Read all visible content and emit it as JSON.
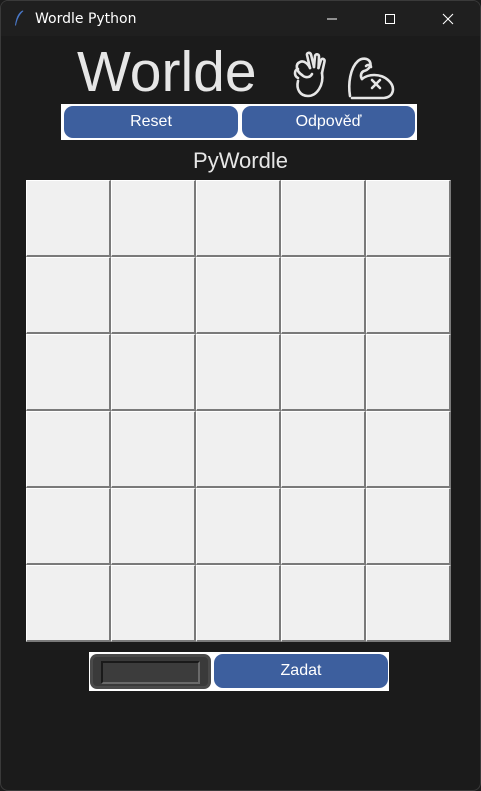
{
  "window": {
    "title": "Wordle Python",
    "icon": "feather-icon",
    "controls": [
      "minimize-icon",
      "maximize-icon",
      "close-icon"
    ]
  },
  "header": {
    "title": "Worlde",
    "icons": [
      "ok-hand-icon",
      "flexed-biceps-icon"
    ]
  },
  "buttons": {
    "reset_label": "Reset",
    "answer_label": "Odpověď"
  },
  "subtitle": "PyWordle",
  "board": {
    "rows": 6,
    "columns": 5,
    "cells": [
      [
        "",
        "",
        "",
        "",
        ""
      ],
      [
        "",
        "",
        "",
        "",
        ""
      ],
      [
        "",
        "",
        "",
        "",
        ""
      ],
      [
        "",
        "",
        "",
        "",
        ""
      ],
      [
        "",
        "",
        "",
        "",
        ""
      ],
      [
        "",
        "",
        "",
        "",
        ""
      ]
    ]
  },
  "entry": {
    "value": "",
    "submit_label": "Zadat"
  },
  "colors": {
    "background": "#1b1b1b",
    "button_blue": "#3d5f9e",
    "cell": "#f0f0f0",
    "title_text": "#e6e6e6"
  }
}
